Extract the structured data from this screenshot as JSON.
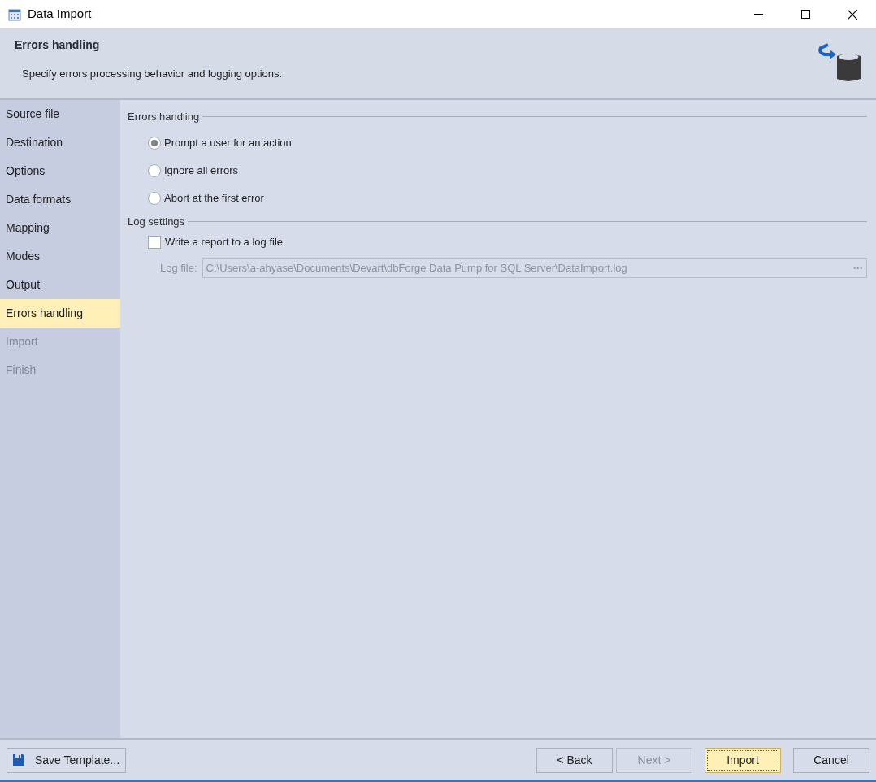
{
  "window": {
    "title": "Data Import"
  },
  "header": {
    "title": "Errors handling",
    "description": "Specify errors processing behavior and logging options."
  },
  "sidebar": {
    "items": [
      {
        "label": "Source file",
        "selected": false,
        "disabled": false
      },
      {
        "label": "Destination",
        "selected": false,
        "disabled": false
      },
      {
        "label": "Options",
        "selected": false,
        "disabled": false
      },
      {
        "label": "Data formats",
        "selected": false,
        "disabled": false
      },
      {
        "label": "Mapping",
        "selected": false,
        "disabled": false
      },
      {
        "label": "Modes",
        "selected": false,
        "disabled": false
      },
      {
        "label": "Output",
        "selected": false,
        "disabled": false
      },
      {
        "label": "Errors handling",
        "selected": true,
        "disabled": false
      },
      {
        "label": "Import",
        "selected": false,
        "disabled": true
      },
      {
        "label": "Finish",
        "selected": false,
        "disabled": true
      }
    ]
  },
  "errors_handling": {
    "title": "Errors handling",
    "options": [
      {
        "label": "Prompt a user for an action",
        "selected": true
      },
      {
        "label": "Ignore all errors",
        "selected": false
      },
      {
        "label": "Abort at the first error",
        "selected": false
      }
    ]
  },
  "log_settings": {
    "title": "Log settings",
    "checkbox": {
      "label": "Write a report to a log file",
      "checked": false
    },
    "log_file": {
      "label": "Log file:",
      "value": "C:\\Users\\a-ahyase\\Documents\\Devart\\dbForge Data Pump for SQL Server\\DataImport.log",
      "disabled": true,
      "browse": "···"
    }
  },
  "footer": {
    "save_template": "Save Template...",
    "buttons": [
      {
        "label": "< Back",
        "disabled": false,
        "default": false
      },
      {
        "label": "Next >",
        "disabled": true,
        "default": false
      },
      {
        "label": "Import",
        "disabled": false,
        "default": true
      },
      {
        "label": "Cancel",
        "disabled": false,
        "default": false
      }
    ]
  }
}
